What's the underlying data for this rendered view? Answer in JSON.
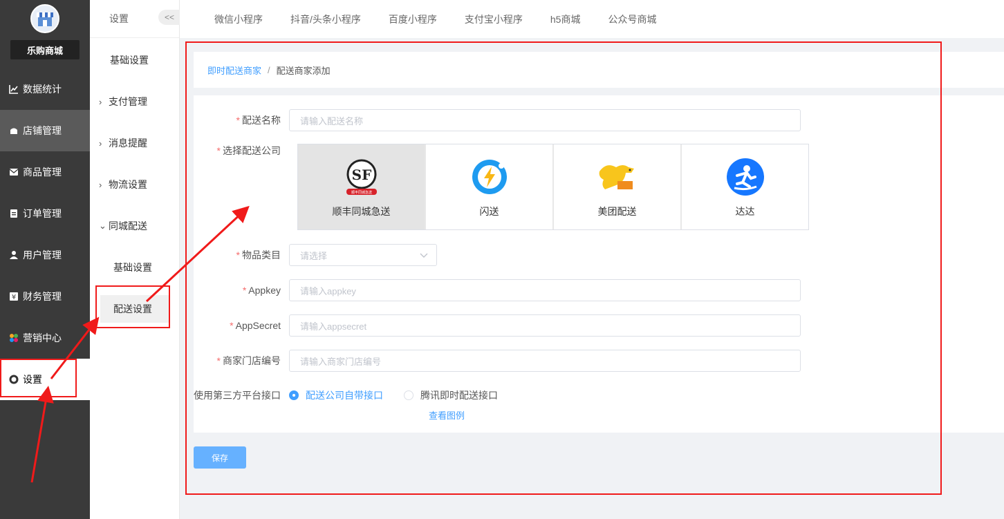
{
  "sidebar": {
    "shop_name": "乐购商城",
    "items": [
      {
        "label": "数据统计",
        "icon": "chart-line-icon"
      },
      {
        "label": "店铺管理",
        "icon": "store-icon"
      },
      {
        "label": "商品管理",
        "icon": "mail-box-icon"
      },
      {
        "label": "订单管理",
        "icon": "clipboard-icon"
      },
      {
        "label": "用户管理",
        "icon": "user-icon"
      },
      {
        "label": "财务管理",
        "icon": "yen-icon"
      },
      {
        "label": "营销中心",
        "icon": "colorful-pinwheel-icon"
      },
      {
        "label": "设置",
        "icon": "gear-ring-icon"
      }
    ]
  },
  "subbar": {
    "title": "设置",
    "collapse": "<<",
    "items": [
      {
        "label": "基础设置"
      },
      {
        "label": "支付管理"
      },
      {
        "label": "消息提醒"
      },
      {
        "label": "物流设置"
      },
      {
        "label": "同城配送"
      },
      {
        "label": "基础设置"
      },
      {
        "label": "配送设置"
      }
    ]
  },
  "tabs": [
    "微信小程序",
    "抖音/头条小程序",
    "百度小程序",
    "支付宝小程序",
    "h5商城",
    "公众号商城"
  ],
  "breadcrumb": {
    "link": "即时配送商家",
    "sep": "/",
    "current": "配送商家添加"
  },
  "form": {
    "name_label": "配送名称",
    "name_placeholder": "请输入配送名称",
    "company_label": "选择配送公司",
    "companies": [
      {
        "name": "顺丰同城急送",
        "logo_sub": "顺丰同城急送"
      },
      {
        "name": "闪送"
      },
      {
        "name": "美团配送"
      },
      {
        "name": "达达"
      }
    ],
    "category_label": "物品类目",
    "category_placeholder": "请选择",
    "appkey_label": "Appkey",
    "appkey_placeholder": "请输入appkey",
    "appsecret_label": "AppSecret",
    "appsecret_placeholder": "请输入appsecret",
    "store_label": "商家门店编号",
    "store_placeholder": "请输入商家门店编号",
    "interface_label": "使用第三方平台接口",
    "radio_own": "配送公司自带接口",
    "radio_tencent": "腾讯即时配送接口",
    "example_link": "查看图例",
    "save": "保存"
  },
  "colors": {
    "accent": "#409eff",
    "annotation": "#f01a1a",
    "sidebar": "#3a3a3a"
  }
}
